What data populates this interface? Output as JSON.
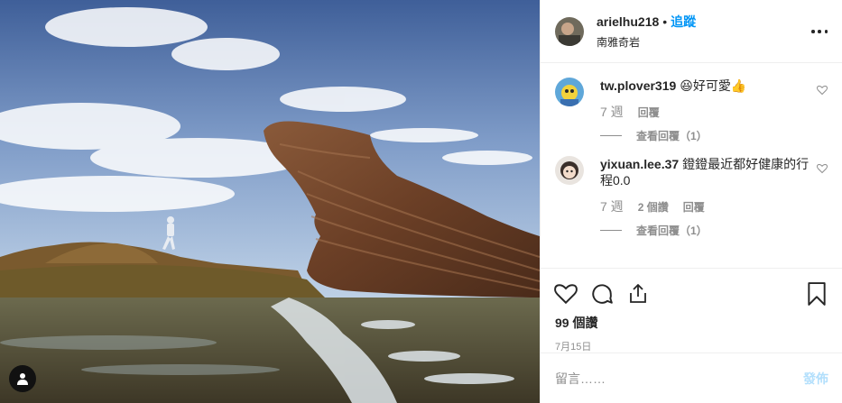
{
  "post": {
    "username": "arielhu218",
    "dot": "•",
    "follow_label": "追蹤",
    "location": "南雅奇岩",
    "more_icon": "more-options-icon"
  },
  "comments": [
    {
      "username": "tw.plover319",
      "text": "😆好可愛👍",
      "time": "7 週",
      "likes": "",
      "reply_label": "回覆",
      "view_replies": "查看回覆（1）"
    },
    {
      "username": "yixuan.lee.37",
      "text": "鐙鐙最近都好健康的行程0.0",
      "time": "7 週",
      "likes": "2 個讚",
      "reply_label": "回覆",
      "view_replies": "查看回覆（1）"
    }
  ],
  "likes_text": "99 個讚",
  "date": "7月15日",
  "comment_box": {
    "placeholder": "留言……",
    "post_label": "發佈"
  },
  "icons": [
    "heart-icon",
    "comment-icon",
    "share-icon",
    "bookmark-icon",
    "user-tag-icon"
  ],
  "colors": {
    "accent": "#0095f6",
    "post_disabled": "#b2dffc",
    "muted": "#8e8e8e"
  }
}
